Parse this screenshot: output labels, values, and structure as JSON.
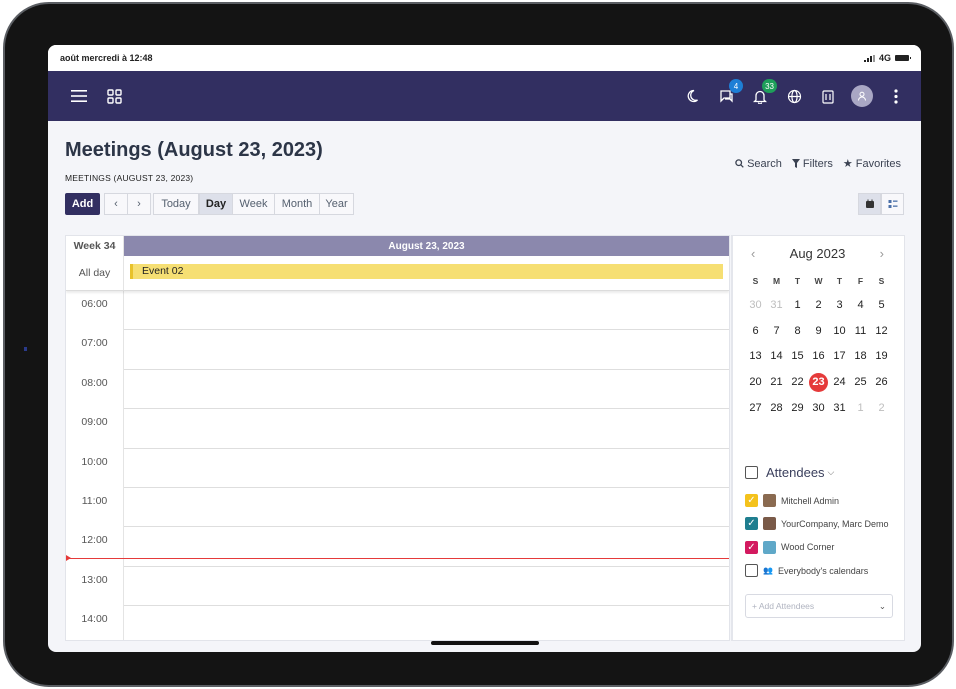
{
  "status_bar": {
    "time": "août mercredi à 12:48",
    "network": "4G"
  },
  "navbar": {
    "messages_badge": "4",
    "activity_badge": "33"
  },
  "page": {
    "title": "Meetings (August 23, 2023)",
    "breadcrumb": "MEETINGS (AUGUST 23, 2023)",
    "search_label": "Search",
    "filters_label": "Filters",
    "favorites_label": "Favorites"
  },
  "toolbar": {
    "add_label": "Add",
    "prev_label": "‹",
    "next_label": "›",
    "today_label": "Today",
    "scales": [
      "Day",
      "Week",
      "Month",
      "Year"
    ],
    "active_scale": "Day"
  },
  "calendar": {
    "week_label": "Week 34",
    "day_header": "August 23, 2023",
    "allday_label": "All day",
    "allday_event": "Event 02",
    "hours": [
      "06:00",
      "07:00",
      "08:00",
      "09:00",
      "10:00",
      "11:00",
      "12:00",
      "13:00",
      "14:00"
    ]
  },
  "mini_calendar": {
    "title": "Aug 2023",
    "weekdays": [
      "S",
      "M",
      "T",
      "W",
      "T",
      "F",
      "S"
    ],
    "weeks": [
      [
        "30",
        "31",
        "1",
        "2",
        "3",
        "4",
        "5"
      ],
      [
        "6",
        "7",
        "8",
        "9",
        "10",
        "11",
        "12"
      ],
      [
        "13",
        "14",
        "15",
        "16",
        "17",
        "18",
        "19"
      ],
      [
        "20",
        "21",
        "22",
        "23",
        "24",
        "25",
        "26"
      ],
      [
        "27",
        "28",
        "29",
        "30",
        "31",
        "1",
        "2"
      ]
    ],
    "today": "23"
  },
  "attendees": {
    "title": "Attendees",
    "items": [
      {
        "name": "Mitchell Admin",
        "checked": true,
        "color": "#f4c21c"
      },
      {
        "name": "YourCompany, Marc Demo",
        "checked": true,
        "color": "#1f7e8f"
      },
      {
        "name": "Wood Corner",
        "checked": true,
        "color": "#d3195f"
      },
      {
        "name": "Everybody's calendars",
        "checked": false,
        "color": "#ffffff"
      }
    ],
    "add_placeholder": "+ Add Attendees"
  }
}
